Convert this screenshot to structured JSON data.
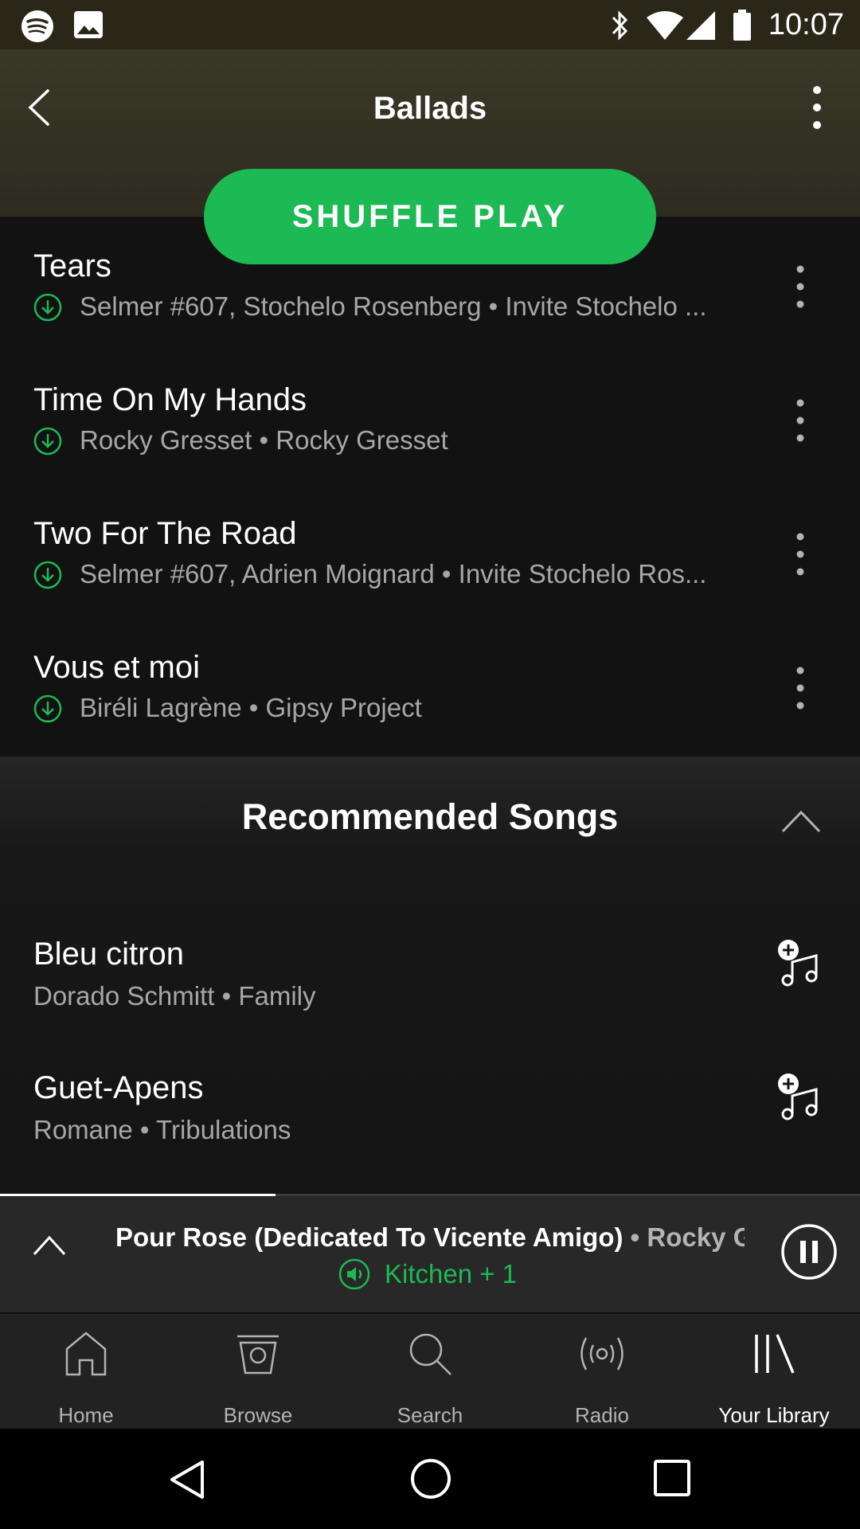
{
  "status_bar": {
    "time": "10:07",
    "left_icons": [
      "spotify-icon",
      "image-icon"
    ],
    "right_icons": [
      "bluetooth-icon",
      "wifi-icon",
      "signal-icon",
      "battery-icon"
    ]
  },
  "header": {
    "title": "Ballads",
    "back_icon": "back-arrow-icon",
    "menu_icon": "more-vertical-icon",
    "shuffle_label": "SHUFFLE PLAY"
  },
  "tracks": [
    {
      "title": "Tears",
      "subtitle": "Selmer #607, Stochelo Rosenberg • Invite Stochelo ...",
      "downloaded": true
    },
    {
      "title": "Time On My Hands",
      "subtitle": "Rocky Gresset • Rocky Gresset",
      "downloaded": true
    },
    {
      "title": "Two For The Road",
      "subtitle": "Selmer #607, Adrien Moignard • Invite Stochelo Ros...",
      "downloaded": true
    },
    {
      "title": "Vous et moi",
      "subtitle": "Biréli Lagrène • Gipsy Project",
      "downloaded": true
    }
  ],
  "recommended": {
    "title": "Recommended Songs",
    "songs": [
      {
        "title": "Bleu citron",
        "subtitle": "Dorado Schmitt • Family"
      },
      {
        "title": "Guet-Apens",
        "subtitle": "Romane • Tribulations"
      }
    ]
  },
  "now_playing": {
    "song": "Pour Rose (Dedicated To Vicente Amigo)",
    "separator": " • ",
    "artist": "Rocky Gresset",
    "device": "Kitchen + 1",
    "progress": 0.32,
    "accent": "#1db954"
  },
  "bottom_nav": {
    "items": [
      {
        "label": "Home",
        "icon": "home-icon",
        "active": false
      },
      {
        "label": "Browse",
        "icon": "browse-icon",
        "active": false
      },
      {
        "label": "Search",
        "icon": "search-icon",
        "active": false
      },
      {
        "label": "Radio",
        "icon": "radio-icon",
        "active": false
      },
      {
        "label": "Your Library",
        "icon": "library-icon",
        "active": true
      }
    ]
  },
  "system_nav": [
    "back-triangle-icon",
    "home-circle-icon",
    "recents-square-icon"
  ]
}
